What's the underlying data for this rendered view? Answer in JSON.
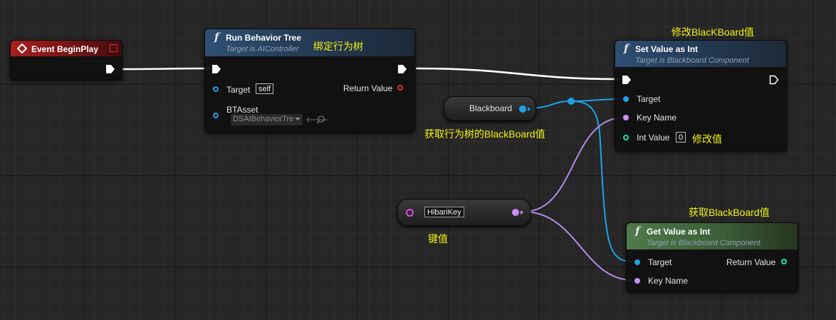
{
  "colors": {
    "accent_object": "#1ea2e6",
    "accent_name": "#c88ff5",
    "accent_int": "#1fe0b0",
    "exec": "#ffffff",
    "return_red": "#e03030"
  },
  "event_node": {
    "title": "Event BeginPlay"
  },
  "run_bt_node": {
    "title": "Run Behavior Tree",
    "subtitle": "Target is AIController",
    "target_label": "Target",
    "target_value": "self",
    "return_label": "Return Value",
    "btasset_label": "BTAsset",
    "btasset_value": "DSAIBehaviorTre"
  },
  "set_value_node": {
    "title": "Set Value as Int",
    "subtitle": "Target is Blackboard Component",
    "target_label": "Target",
    "keyname_label": "Key Name",
    "intvalue_label": "Int Value",
    "intvalue_value": "0"
  },
  "get_value_node": {
    "title": "Get Value as Int",
    "subtitle": "Target is Blackboard Component",
    "target_label": "Target",
    "return_label": "Return Value",
    "keyname_label": "Key Name"
  },
  "blackboard_var": {
    "label": "Blackboard"
  },
  "name_literal": {
    "value": "HibariKey"
  },
  "annotations": {
    "bind_tree": "绑定行为树",
    "modify_blackboard": "修改BlacKBoard值",
    "get_tree_blackboard": "获取行为树的BlackBoard值",
    "modify_value": "修改值",
    "get_blackboard": "获取BlackBoard值",
    "key_value": "键值"
  }
}
